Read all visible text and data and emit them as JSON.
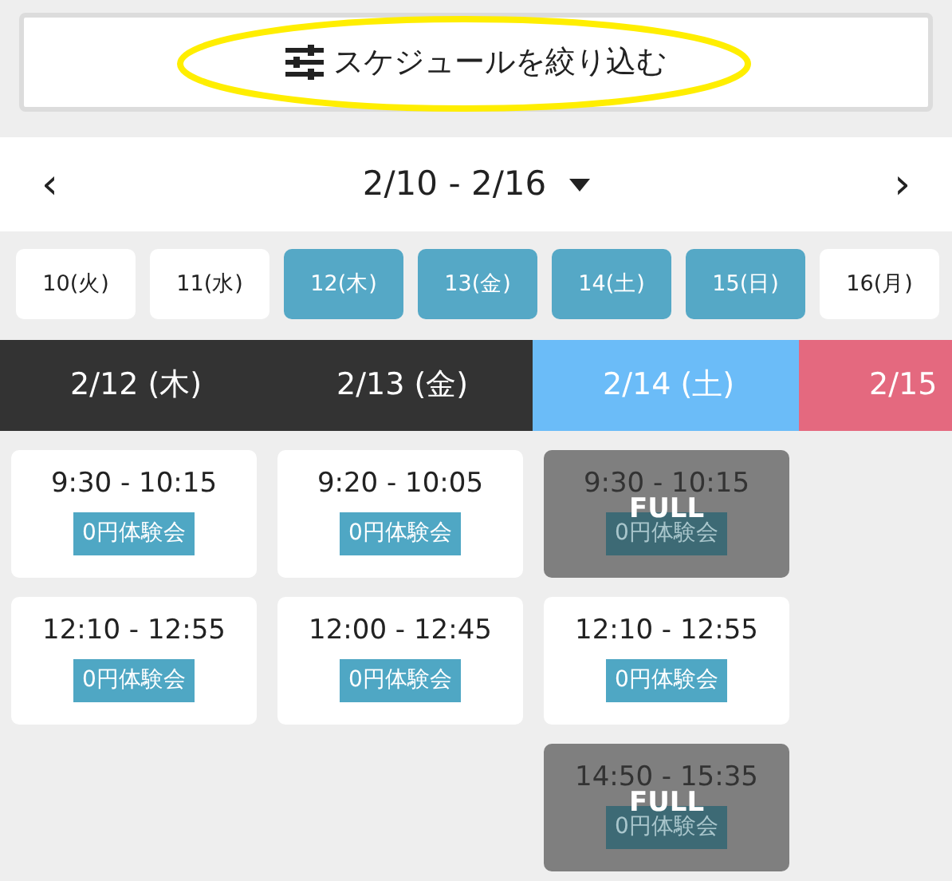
{
  "filter_button": {
    "label": "スケジュールを絞り込む",
    "highlighted": true
  },
  "week_nav": {
    "prev": "‹",
    "range": "2/10 - 2/16",
    "next": "›"
  },
  "day_chips": [
    {
      "label": "10(火)",
      "selected": false
    },
    {
      "label": "11(水)",
      "selected": false
    },
    {
      "label": "12(木)",
      "selected": true
    },
    {
      "label": "13(金)",
      "selected": true
    },
    {
      "label": "14(土)",
      "selected": true
    },
    {
      "label": "15(日)",
      "selected": true
    },
    {
      "label": "16(月)",
      "selected": false
    }
  ],
  "days": [
    {
      "header": "2/12 (木)",
      "color": "#333333",
      "slots": [
        {
          "time": "9:30 - 10:15",
          "tag": "0円体験会",
          "full": false
        },
        {
          "time": "12:10 - 12:55",
          "tag": "0円体験会",
          "full": false
        }
      ]
    },
    {
      "header": "2/13 (金)",
      "color": "#333333",
      "slots": [
        {
          "time": "9:20 - 10:05",
          "tag": "0円体験会",
          "full": false
        },
        {
          "time": "12:00 - 12:45",
          "tag": "0円体験会",
          "full": false
        }
      ]
    },
    {
      "header": "2/14 (土)",
      "color": "#6bbcf8",
      "slots": [
        {
          "time": "9:30 - 10:15",
          "tag": "0円体験会",
          "full": true,
          "full_label": "FULL"
        },
        {
          "time": "12:10 - 12:55",
          "tag": "0円体験会",
          "full": false
        },
        {
          "time": "14:50 - 15:35",
          "tag": "0円体験会",
          "full": true,
          "full_label": "FULL"
        }
      ]
    },
    {
      "header": "2/15",
      "color": "#e4697f"
    }
  ]
}
